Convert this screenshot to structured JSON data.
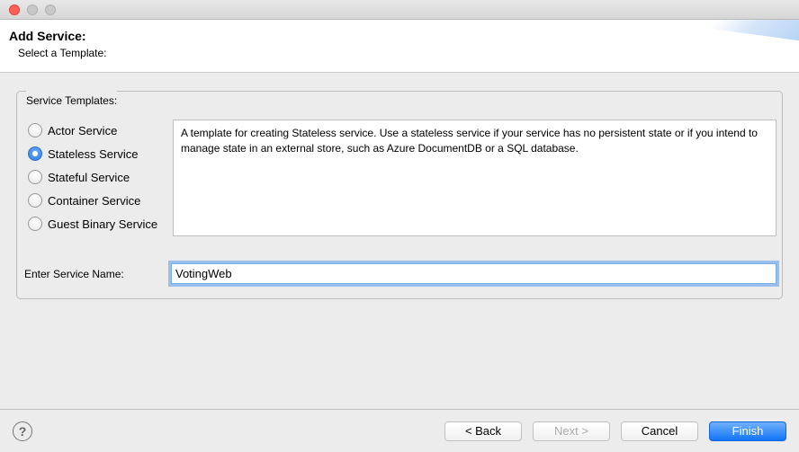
{
  "window": {
    "title": "Add Service:",
    "subtitle": "Select a Template:"
  },
  "section": {
    "label": "Service Templates:"
  },
  "templates": [
    {
      "label": "Actor Service",
      "selected": false
    },
    {
      "label": "Stateless Service",
      "selected": true
    },
    {
      "label": "Stateful Service",
      "selected": false
    },
    {
      "label": "Container Service",
      "selected": false
    },
    {
      "label": "Guest Binary Service",
      "selected": false
    }
  ],
  "description": "A template for creating Stateless service.  Use a stateless service if your service has no persistent state or if you intend to manage state in an external store, such as Azure DocumentDB or a SQL database.",
  "serviceName": {
    "label": "Enter Service Name:",
    "value": "VotingWeb"
  },
  "footer": {
    "back": "< Back",
    "next": "Next >",
    "cancel": "Cancel",
    "finish": "Finish",
    "nextEnabled": false
  }
}
